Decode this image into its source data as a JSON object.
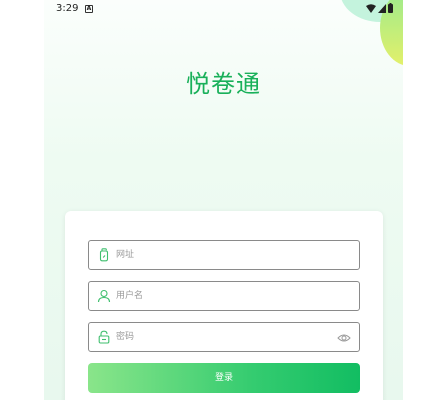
{
  "status_bar": {
    "time": "3:29",
    "notification_glyph": "A"
  },
  "app": {
    "title": "悦卷通"
  },
  "form": {
    "url_placeholder": "网址",
    "username_placeholder": "用户名",
    "password_placeholder": "密码",
    "login_label": "登录"
  },
  "icons": {
    "url": "link-icon",
    "user": "user-icon",
    "password": "lock-icon",
    "visibility": "eye-icon"
  },
  "colors": {
    "brand": "#19b05a",
    "button_start": "#8ae58a",
    "button_end": "#12bd62",
    "icon": "#3fbf6e"
  }
}
